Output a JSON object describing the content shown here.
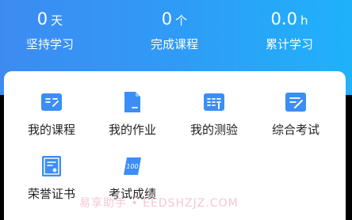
{
  "stats": [
    {
      "value": "0",
      "unit": "天",
      "label": "坚持学习"
    },
    {
      "value": "0",
      "unit": "个",
      "label": "完成课程"
    },
    {
      "value": "0.0",
      "unit": "h",
      "label": "累计学习"
    }
  ],
  "menu": [
    {
      "label": "我的课程",
      "icon": "book-open-icon"
    },
    {
      "label": "我的作业",
      "icon": "homework-doc-icon"
    },
    {
      "label": "我的测验",
      "icon": "quiz-icon"
    },
    {
      "label": "综合考试",
      "icon": "exam-edit-icon"
    },
    {
      "label": "荣誉证书",
      "icon": "certificate-icon"
    },
    {
      "label": "考试成绩",
      "icon": "score-100-icon"
    }
  ],
  "watermark": "易享助手 • EEDSHZJZ.COM",
  "colors": {
    "accent": "#3A8EF5",
    "header_start": "#3D8BF2",
    "header_end": "#1FB2FB"
  }
}
